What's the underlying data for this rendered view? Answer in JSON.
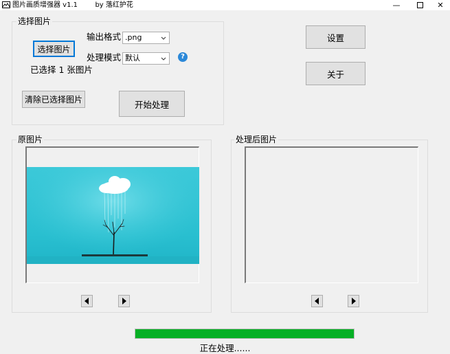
{
  "window": {
    "title": "图片画质增强器 v1.1",
    "author": "by 落红护花",
    "controls": {
      "minimize": "—",
      "close": "✕"
    }
  },
  "select_group": {
    "legend": "选择图片",
    "select_button": "选择图片",
    "selected_count_text": "已选择 1 张图片",
    "clear_button": "清除已选择图片",
    "start_button": "开始处理",
    "output_format_label": "输出格式",
    "output_format_value": ".png",
    "process_mode_label": "处理模式",
    "process_mode_value": "默认",
    "help_glyph": "?"
  },
  "side_buttons": {
    "settings": "设置",
    "about": "关于"
  },
  "original_group": {
    "legend": "原图片",
    "prev_icon": "arrow-left-icon",
    "next_icon": "arrow-right-icon"
  },
  "processed_group": {
    "legend": "处理后图片",
    "prev_icon": "arrow-left-icon",
    "next_icon": "arrow-right-icon"
  },
  "progress": {
    "percent": 100,
    "color": "#06b025"
  },
  "status_text": "正在处理......"
}
